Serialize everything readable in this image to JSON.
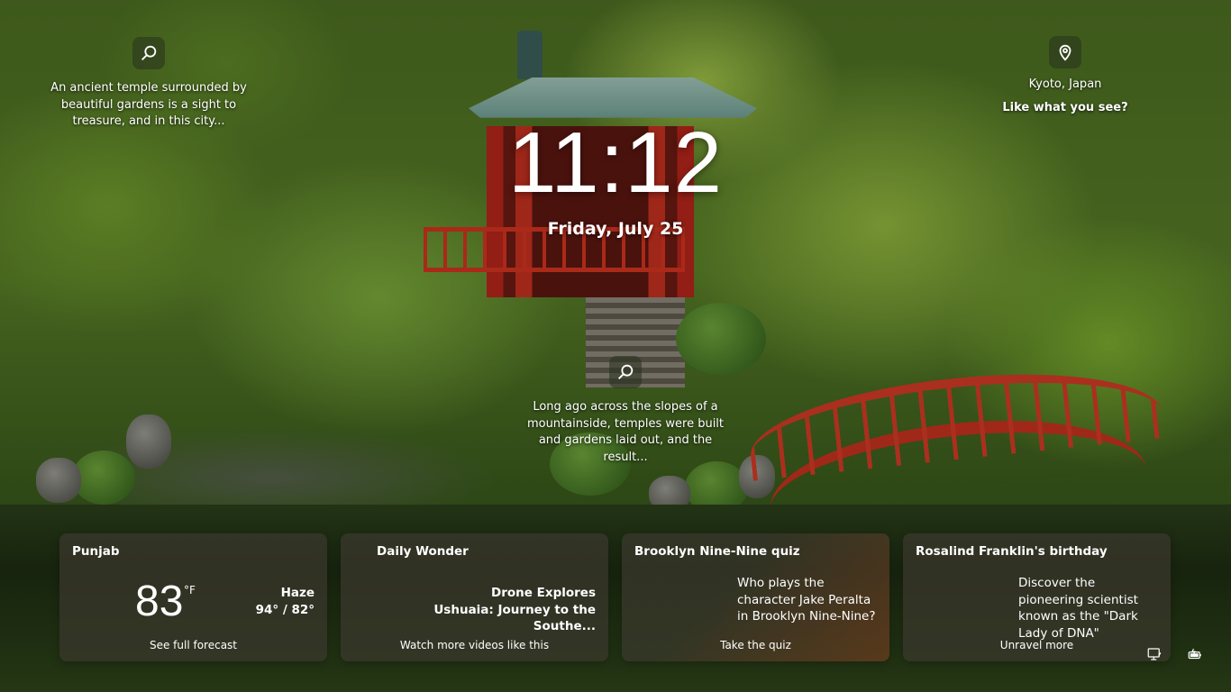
{
  "spotlight": {
    "top_caption": "An ancient temple surrounded by beautiful gardens is a sight to treasure, and in this city...",
    "mid_caption": "Long ago across the slopes of a mountainside, temples were built and gardens laid out, and the result...",
    "location": "Kyoto, Japan",
    "like_prompt": "Like what you see?"
  },
  "lock": {
    "time": "11:12",
    "date": "Friday, July 25"
  },
  "widgets": {
    "weather": {
      "title": "Punjab",
      "temperature": "83",
      "unit": "°F",
      "condition": "Haze",
      "range": "94° / 82°",
      "footer": "See full forecast"
    },
    "daily_wonder": {
      "title": "Daily Wonder",
      "headline": "Drone Explores Ushuaia: Journey to the Southe...",
      "footer": "Watch more videos like this"
    },
    "quiz": {
      "title": "Brooklyn Nine-Nine quiz",
      "text": "Who plays the character Jake Peralta in Brooklyn Nine-Nine?",
      "footer": "Take the quiz"
    },
    "birthday": {
      "title": "Rosalind Franklin's birthday",
      "text": "Discover the pioneering scientist known as the \"Dark Lady of DNA\"",
      "footer": "Unravel more"
    }
  },
  "tray": {
    "icons": [
      "network-icon",
      "battery-icon"
    ]
  }
}
